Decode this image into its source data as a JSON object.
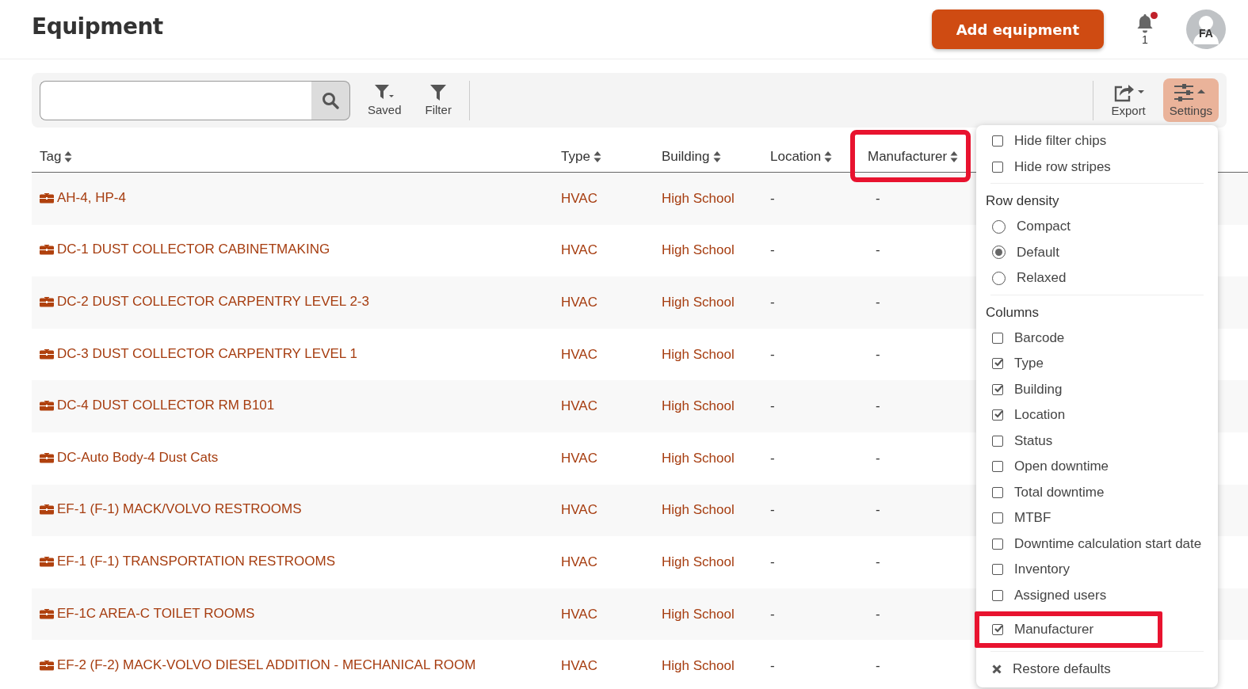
{
  "header": {
    "title": "Equipment",
    "add_button": "Add equipment",
    "notifications": {
      "count": "1",
      "unread": true
    },
    "avatar": "FA"
  },
  "toolbar": {
    "buttons": [
      {
        "label": "Saved",
        "kind": "saved",
        "selected": false
      },
      {
        "label": "Filter",
        "kind": "filter",
        "selected": false
      }
    ],
    "right_buttons": [
      {
        "label": "Export",
        "kind": "export",
        "selected": false
      },
      {
        "label": "Settings",
        "kind": "settings",
        "selected": true
      }
    ]
  },
  "table": {
    "columns": [
      {
        "label": "Tag",
        "highlighted": false
      },
      {
        "label": "Type",
        "highlighted": false
      },
      {
        "label": "Building",
        "highlighted": false
      },
      {
        "label": "Location",
        "highlighted": false
      },
      {
        "label": "Manufacturer",
        "highlighted": true
      }
    ],
    "rows": [
      {
        "tag": "AH-4, HP-4",
        "type": "HVAC",
        "building": "High School",
        "location": "-",
        "manufacturer": "-"
      },
      {
        "tag": "DC-1 DUST COLLECTOR CABINETMAKING",
        "type": "HVAC",
        "building": "High School",
        "location": "-",
        "manufacturer": "-"
      },
      {
        "tag": "DC-2 DUST COLLECTOR CARPENTRY LEVEL 2-3",
        "type": "HVAC",
        "building": "High School",
        "location": "-",
        "manufacturer": "-"
      },
      {
        "tag": "DC-3 DUST COLLECTOR CARPENTRY LEVEL 1",
        "type": "HVAC",
        "building": "High School",
        "location": "-",
        "manufacturer": "-"
      },
      {
        "tag": "DC-4 DUST COLLECTOR RM B101",
        "type": "HVAC",
        "building": "High School",
        "location": "-",
        "manufacturer": "-"
      },
      {
        "tag": "DC-Auto Body-4 Dust Cats",
        "type": "HVAC",
        "building": "High School",
        "location": "-",
        "manufacturer": "-"
      },
      {
        "tag": "EF-1 (F-1) MACK/VOLVO RESTROOMS",
        "type": "HVAC",
        "building": "High School",
        "location": "-",
        "manufacturer": "-"
      },
      {
        "tag": "EF-1 (F-1) TRANSPORTATION RESTROOMS",
        "type": "HVAC",
        "building": "High School",
        "location": "-",
        "manufacturer": "-"
      },
      {
        "tag": "EF-1C AREA-C TOILET ROOMS",
        "type": "HVAC",
        "building": "High School",
        "location": "-",
        "manufacturer": "-"
      },
      {
        "tag": "EF-2 (F-2) MACK-VOLVO DIESEL ADDITION - MECHANICAL ROOM",
        "type": "HVAC",
        "building": "High School",
        "location": "-",
        "manufacturer": "-"
      }
    ]
  },
  "settings_menu": {
    "options": [
      {
        "label": "Hide filter chips",
        "checked": false
      },
      {
        "label": "Hide row stripes",
        "checked": false
      }
    ],
    "row_density": {
      "title": "Row density",
      "choices": [
        {
          "label": "Compact",
          "selected": false
        },
        {
          "label": "Default",
          "selected": true
        },
        {
          "label": "Relaxed",
          "selected": false
        }
      ]
    },
    "columns": {
      "title": "Columns",
      "items": [
        {
          "label": "Barcode",
          "checked": false,
          "highlighted": false
        },
        {
          "label": "Type",
          "checked": true,
          "highlighted": false
        },
        {
          "label": "Building",
          "checked": true,
          "highlighted": false
        },
        {
          "label": "Location",
          "checked": true,
          "highlighted": false
        },
        {
          "label": "Status",
          "checked": false,
          "highlighted": false
        },
        {
          "label": "Open downtime",
          "checked": false,
          "highlighted": false
        },
        {
          "label": "Total downtime",
          "checked": false,
          "highlighted": false
        },
        {
          "label": "MTBF",
          "checked": false,
          "highlighted": false
        },
        {
          "label": "Downtime calculation start date",
          "checked": false,
          "highlighted": false
        },
        {
          "label": "Inventory",
          "checked": false,
          "highlighted": false
        },
        {
          "label": "Assigned users",
          "checked": false,
          "highlighted": false
        },
        {
          "label": "Manufacturer",
          "checked": true,
          "highlighted": true
        }
      ]
    },
    "restore": "Restore defaults"
  }
}
